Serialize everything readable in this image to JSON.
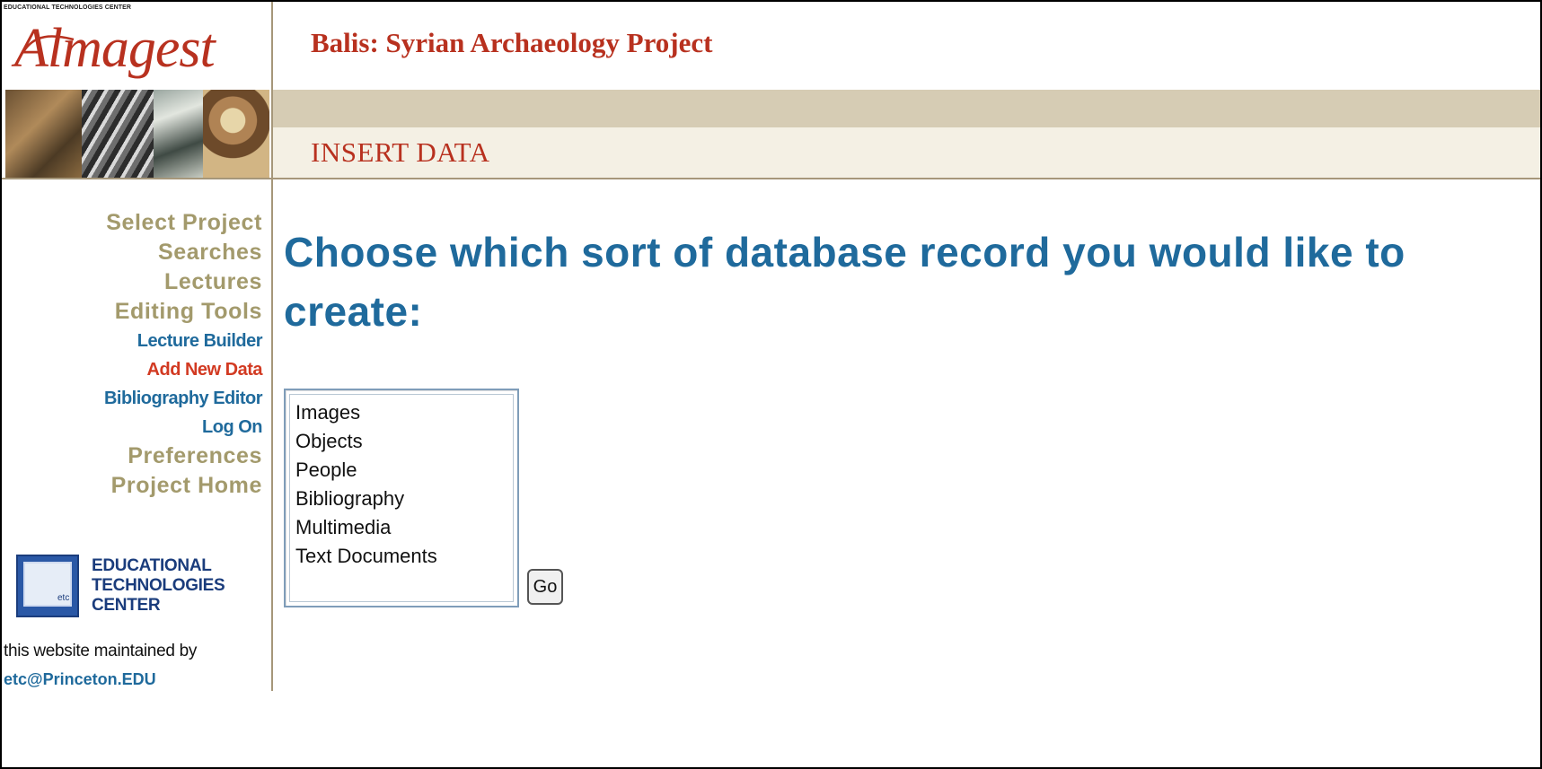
{
  "header": {
    "etc_small": "EDUCATIONAL TECHNOLOGIES CENTER",
    "logo_text": "Almagest",
    "project_title": "Balis: Syrian Archaeology Project",
    "section_title": "INSERT DATA"
  },
  "sidebar": {
    "nav": [
      {
        "label": "Select Project"
      },
      {
        "label": "Searches"
      },
      {
        "label": "Lectures"
      },
      {
        "label": "Editing Tools"
      },
      {
        "label": "Lecture Builder"
      },
      {
        "label": "Add New Data"
      },
      {
        "label": "Bibliography Editor"
      },
      {
        "label": "Log On"
      },
      {
        "label": "Preferences"
      },
      {
        "label": "Project Home"
      }
    ],
    "etc_logo": {
      "box_text": "etc",
      "line1": "EDUCATIONAL",
      "line2": "TECHNOLOGIES",
      "line3": "CENTER"
    },
    "maintained_text": "this website maintained by",
    "email": "etc@Princeton.EDU"
  },
  "main": {
    "heading": "Choose which sort of database record you would like to create:",
    "record_types": [
      "Images",
      "Objects",
      "People",
      "Bibliography",
      "Multimedia",
      "Text Documents"
    ],
    "go_label": "Go"
  },
  "colors": {
    "brand_red": "#b8311f",
    "link_blue": "#1f6a9c",
    "nav_olive": "#a39a6c",
    "active_red": "#d23a22",
    "band_tan": "#d6ccb4"
  }
}
